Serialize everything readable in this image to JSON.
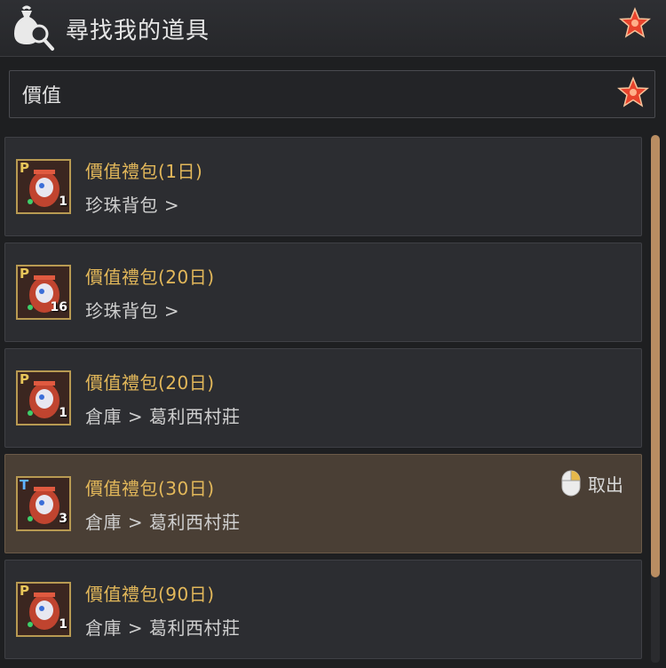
{
  "header": {
    "title": "尋找我的道具",
    "icon": "bag-search-icon",
    "favorite_icon": "star-icon"
  },
  "search": {
    "value": "價值",
    "favorite_icon": "star-icon"
  },
  "items": [
    {
      "name": "價值禮包(1日)",
      "location": "珍珠背包 >",
      "quantity": "1",
      "mark": "P",
      "selected": false
    },
    {
      "name": "價值禮包(20日)",
      "location": "珍珠背包 >",
      "quantity": "16",
      "mark": "P",
      "selected": false
    },
    {
      "name": "價值禮包(20日)",
      "location": "倉庫 > 葛利西村莊",
      "quantity": "1",
      "mark": "P",
      "selected": false
    },
    {
      "name": "價值禮包(30日)",
      "location": "倉庫 > 葛利西村莊",
      "quantity": "3",
      "mark": "T",
      "selected": true,
      "action_label": "取出",
      "action_icon": "mouse-right-click-icon"
    },
    {
      "name": "價值禮包(90日)",
      "location": "倉庫 > 葛利西村莊",
      "quantity": "1",
      "mark": "P",
      "selected": false
    }
  ],
  "scrollbar": {
    "position": 0
  },
  "colors": {
    "item_name": "#e3b85a",
    "selected_row": "#4a3f35",
    "scroll_thumb": "#b98d62",
    "star": "#e8432c"
  }
}
